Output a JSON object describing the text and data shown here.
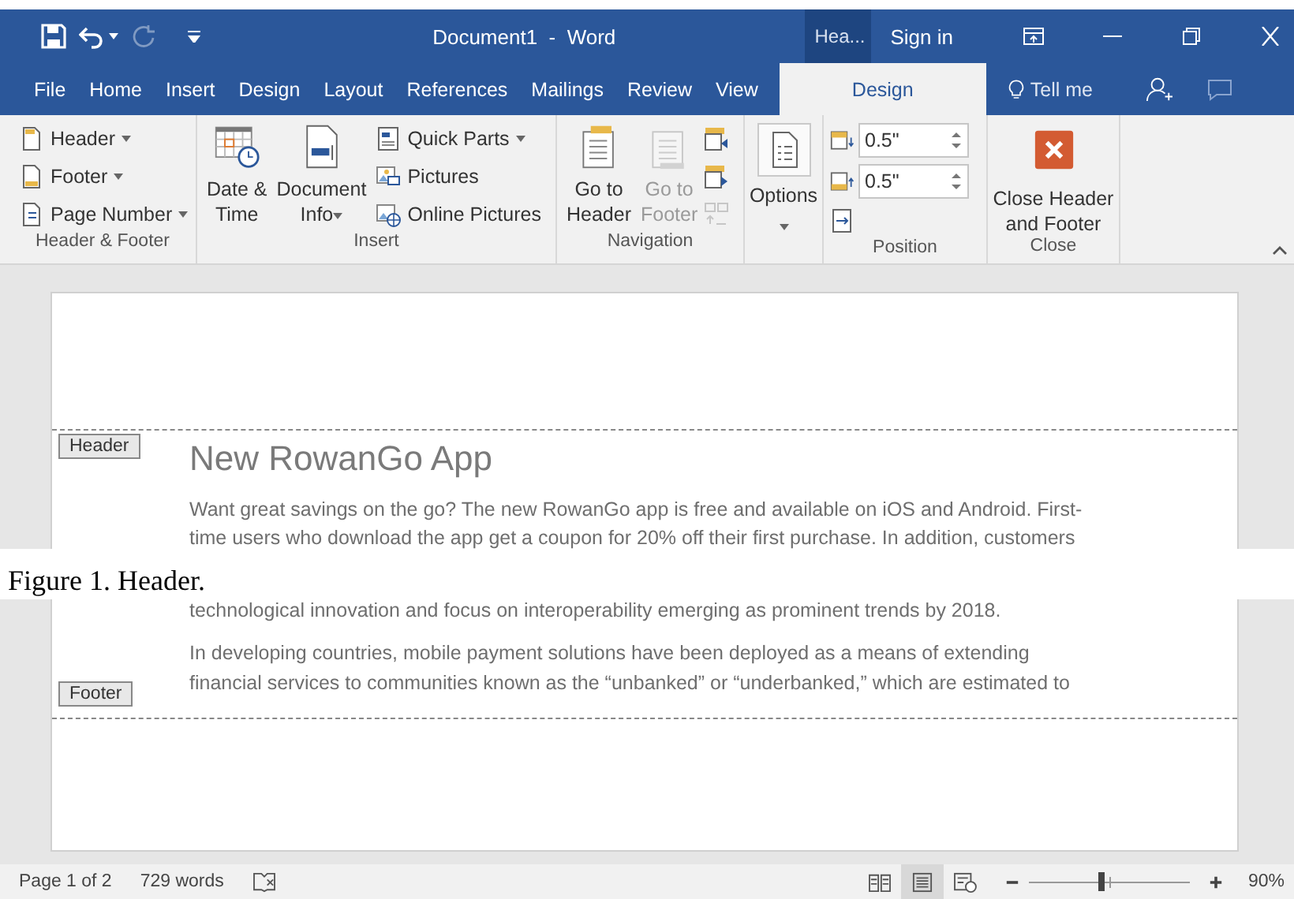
{
  "title_bar": {
    "title": "Document1  -  Word",
    "contextual_tab": "Hea...",
    "sign_in": "Sign in",
    "redo_disabled": true
  },
  "tabs": [
    {
      "label": "File",
      "selected": false
    },
    {
      "label": "Home",
      "selected": false
    },
    {
      "label": "Insert",
      "selected": false
    },
    {
      "label": "Design",
      "selected": false
    },
    {
      "label": "Layout",
      "selected": false
    },
    {
      "label": "References",
      "selected": false
    },
    {
      "label": "Mailings",
      "selected": false
    },
    {
      "label": "Review",
      "selected": false
    },
    {
      "label": "View",
      "selected": false
    },
    {
      "label": "Design",
      "selected": true
    }
  ],
  "tell_me": "Tell me",
  "ribbon": {
    "groups": [
      {
        "label": "Header & Footer",
        "items": [
          {
            "kind": "small",
            "label": "Header",
            "dropdown": true
          },
          {
            "kind": "small",
            "label": "Footer",
            "dropdown": true
          },
          {
            "kind": "small",
            "label": "Page Number",
            "dropdown": true
          }
        ]
      },
      {
        "label": "Insert",
        "items": [
          {
            "kind": "large",
            "lines": [
              "Date &",
              "Time"
            ],
            "dropdown": false
          },
          {
            "kind": "large",
            "lines": [
              "Document",
              "Info"
            ],
            "dropdown": true
          },
          {
            "kind": "small",
            "label": "Quick Parts",
            "dropdown": true
          },
          {
            "kind": "small",
            "label": "Pictures",
            "dropdown": false
          },
          {
            "kind": "small",
            "label": "Online Pictures",
            "dropdown": false
          }
        ]
      },
      {
        "label": "Navigation",
        "items": [
          {
            "kind": "large",
            "lines": [
              "Go to",
              "Header"
            ],
            "disabled": false
          },
          {
            "kind": "large",
            "lines": [
              "Go to",
              "Footer"
            ],
            "disabled": true
          },
          {
            "kind": "icon",
            "disabled": false
          },
          {
            "kind": "icon",
            "disabled": false
          },
          {
            "kind": "icon",
            "disabled": true
          }
        ]
      },
      {
        "items": [
          {
            "kind": "large",
            "lines": [
              "Options"
            ],
            "dropdown": true
          }
        ]
      },
      {
        "label": "Position",
        "items": [
          {
            "kind": "spinner",
            "value": "0.5\""
          },
          {
            "kind": "spinner",
            "value": "0.5\""
          },
          {
            "kind": "icon"
          }
        ]
      },
      {
        "label": "Close",
        "items": [
          {
            "kind": "large",
            "lines": [
              "Close Header",
              "and Footer"
            ],
            "dropdown": false
          }
        ]
      }
    ]
  },
  "document_top": {
    "header_tag": "Header",
    "title": "New RowanGo App",
    "paragraph": "Want great savings on the go? The new RowanGo app is free and available on iOS and Android. First-time users who download the app get a coupon for 20% off their first purchase. In addition, customers"
  },
  "caption": "Figure 1. Header.",
  "document_bottom": {
    "line": "technological innovation and focus on interoperability emerging as prominent trends by 2018.",
    "paragraph": "In developing countries, mobile payment solutions have been deployed as a means of extending financial services to communities known as the “unbanked” or “underbanked,” which are estimated to",
    "footer_tag": "Footer"
  },
  "status_bar": {
    "page": "Page 1 of 2",
    "words": "729 words",
    "views": [
      {
        "selected": false
      },
      {
        "selected": true
      },
      {
        "selected": false
      }
    ],
    "zoom": {
      "level": 0.45,
      "reading": "90%"
    }
  }
}
